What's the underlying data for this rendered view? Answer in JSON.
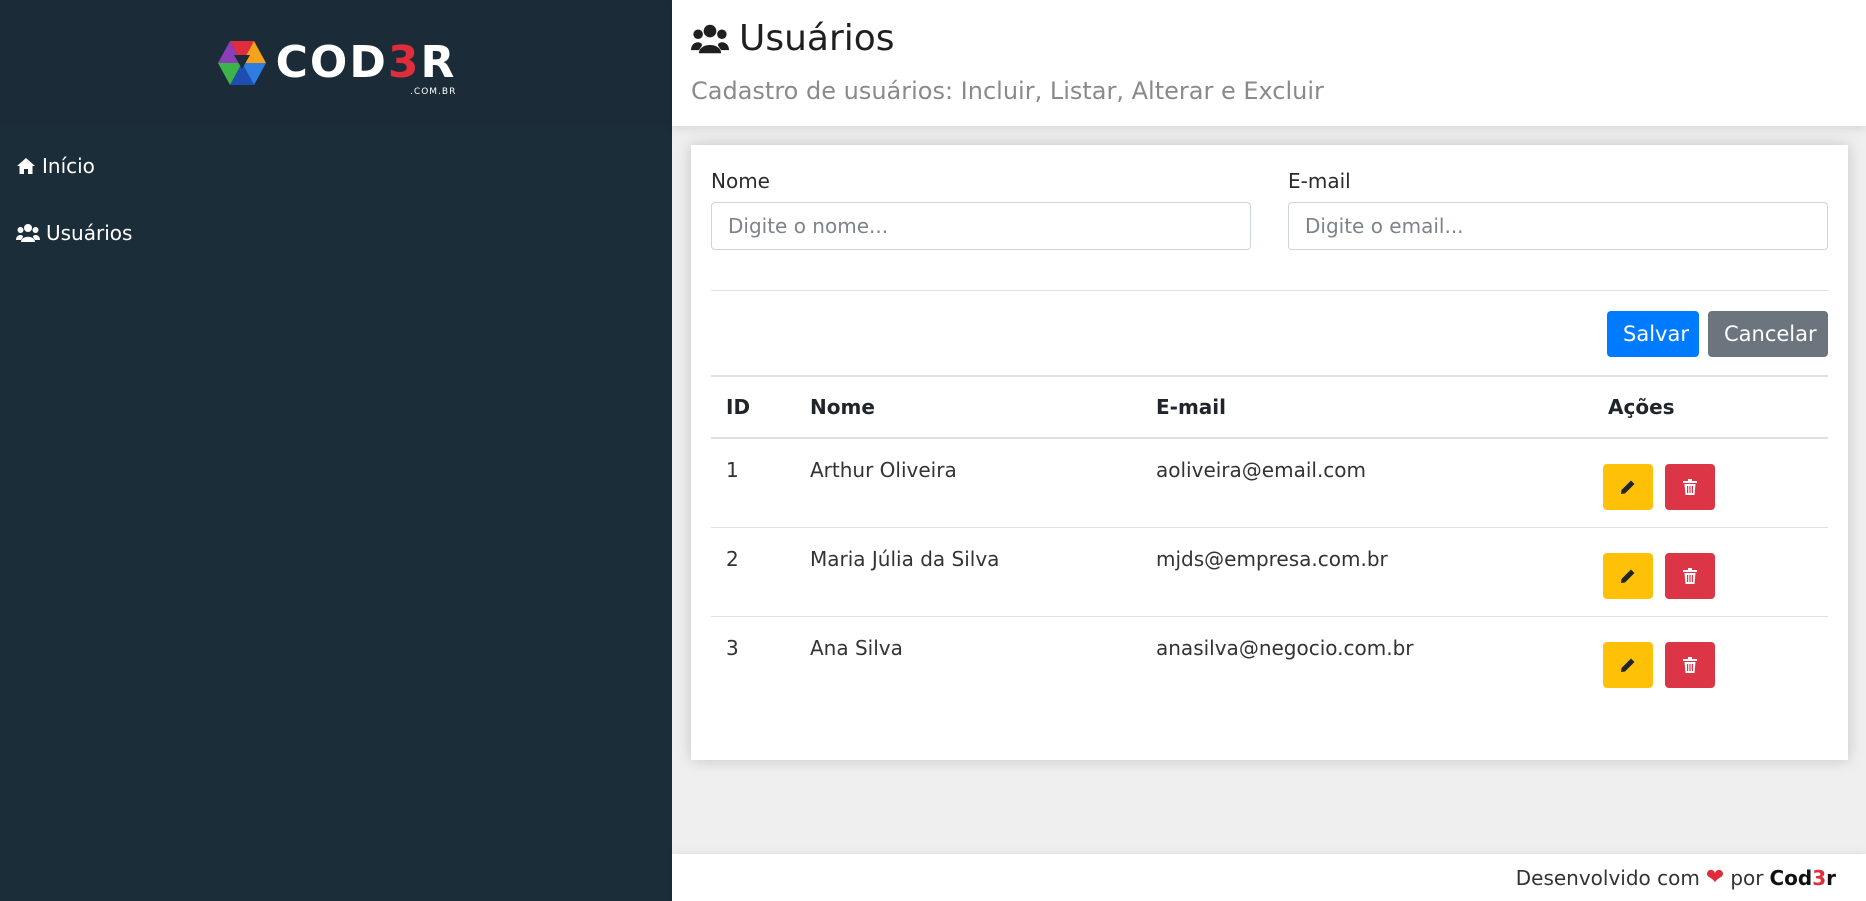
{
  "app": {
    "logo_text_start": "COD",
    "logo_text_accent": "3",
    "logo_text_end": "R",
    "logo_sub": ".COM.BR"
  },
  "sidebar": {
    "items": [
      {
        "label": "Início",
        "icon": "home-icon"
      },
      {
        "label": "Usuários",
        "icon": "users-icon"
      }
    ]
  },
  "header": {
    "title": "Usuários",
    "icon": "users-icon",
    "subtitle": "Cadastro de usuários: Incluir, Listar, Alterar e Excluir"
  },
  "form": {
    "nome_label": "Nome",
    "nome_placeholder": "Digite o nome...",
    "nome_value": "",
    "email_label": "E-mail",
    "email_placeholder": "Digite o email...",
    "email_value": "",
    "save_label": "Salvar",
    "cancel_label": "Cancelar"
  },
  "table": {
    "headers": [
      "ID",
      "Nome",
      "E-mail",
      "Ações"
    ],
    "rows": [
      {
        "id": "1",
        "nome": "Arthur Oliveira",
        "email": "aoliveira@email.com"
      },
      {
        "id": "2",
        "nome": "Maria Júlia da Silva",
        "email": "mjds@empresa.com.br"
      },
      {
        "id": "3",
        "nome": "Ana Silva",
        "email": "anasilva@negocio.com.br"
      }
    ]
  },
  "footer": {
    "text_before": "Desenvolvido com",
    "heart": "❤",
    "text_after": "por",
    "brand_start": "Cod",
    "brand_accent": "3",
    "brand_end": "r"
  },
  "colors": {
    "sidebar_bg": "#1c2d3a",
    "primary": "#007bff",
    "secondary": "#6c757d",
    "warning": "#ffc107",
    "danger": "#dc3545",
    "brand_red": "#e02d3c"
  }
}
